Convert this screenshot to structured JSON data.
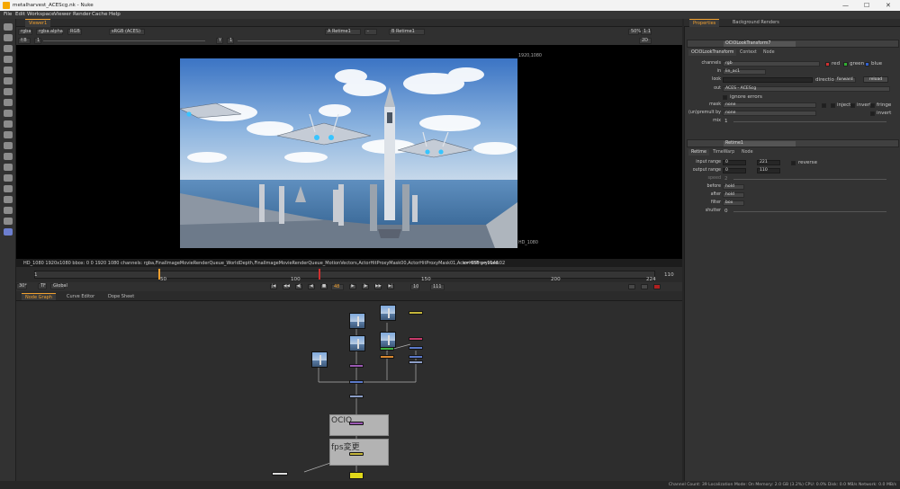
{
  "window": {
    "title": "metalharvest_ACEScg.nk - Nuke",
    "controls": [
      "—",
      "☐",
      "✕"
    ]
  },
  "menu": [
    "File",
    "Edit",
    "Workspace",
    "Viewer",
    "Render",
    "Cache",
    "Help"
  ],
  "viewer": {
    "tab": "Viewer1",
    "channels": "rgba",
    "channel_alpha": "rgba.alpha",
    "display": "RGB",
    "colorspace": "sRGB (ACES)",
    "input_a": "A  Retime1",
    "input_b": "B  Retime1",
    "minus": "-",
    "gain": "f/8",
    "frame_field": "1",
    "gamma": "Y",
    "gamma_val": "1",
    "zoom": "50%",
    "ratio": "1:1",
    "mode": "2D",
    "fmt_top_right": "1920,1080",
    "fmt_bottom_right": "HD_1080",
    "info_text": "HD_1080 1920x1080  bbox: 0 0 1920 1080 channels: rgba,FinalImageMovieRenderQueue_WorldDepth,FinalImageMovieRenderQueue_MotionVectors,ActorHitProxyMask00,ActorHitProxyMask01,ActorHitProxyMask02",
    "coords": "x=-658 y=1146"
  },
  "timeline": {
    "ticks": [
      "1",
      "50",
      "100",
      "150",
      "200",
      "224",
      "110"
    ],
    "in_frame": "1",
    "out_frame": "110",
    "fps": "30*",
    "tf": "TF",
    "scope": "Global",
    "current_frame": "48",
    "skip": "10",
    "end_frame": "111"
  },
  "panel_tabs": [
    "Node Graph",
    "Curve Editor",
    "Dope Sheet"
  ],
  "backdrops": [
    {
      "label": "OCIO"
    },
    {
      "label": "fps変更"
    }
  ],
  "status_bar": "Channel Count: 39  Localization Mode: On  Memory: 2.0 GB (3.2%)  CPU: 0.0%  Disk: 0.0 MB/s  Network: 0.0 MB/s",
  "properties": {
    "tabs": [
      "Properties",
      "Background Renders"
    ],
    "panel1": {
      "name": "OCIOLookTransform7",
      "subtabs": [
        "OCIOLookTransform",
        "Context",
        "Node"
      ],
      "channels_label": "channels",
      "channels_val": "rgb",
      "red": "red",
      "green": "green",
      "blue": "blue",
      "in_label": "in",
      "in_val": "lin_ac1",
      "look_label": "look",
      "direction_label": "direction",
      "direction_val": "forward",
      "reload": "reload",
      "out_label": "out",
      "out_val": "ACES - ACEScg",
      "ignore": "ignore errors",
      "mask_label": "mask",
      "mask_val": "none",
      "inject": "inject",
      "invert": "invert",
      "fringe": "fringe",
      "premult_label": "(un)premult by",
      "premult_val": "none",
      "invert2": "invert",
      "mix_label": "mix",
      "mix_val": "1"
    },
    "panel2": {
      "name": "Retime1",
      "subtabs": [
        "Retime",
        "TimeWarp",
        "Node"
      ],
      "input_label": "input range",
      "input_a": "0",
      "input_b": "221",
      "reverse": "reverse",
      "output_label": "output range",
      "output_a": "0",
      "output_b": "110",
      "speed_label": "speed",
      "speed_val": "2",
      "before_label": "before",
      "before_val": "hold",
      "after_label": "after",
      "after_val": "hold",
      "filter_label": "filter",
      "filter_val": "box",
      "shutter_label": "shutter",
      "shutter_val": "0"
    }
  }
}
